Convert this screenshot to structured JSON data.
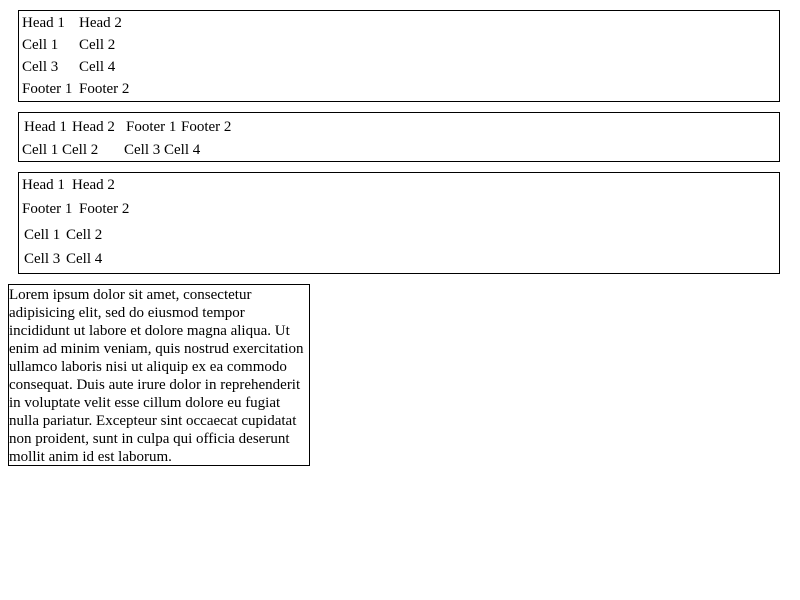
{
  "table1": {
    "head": [
      "Head 1",
      "Head 2"
    ],
    "rows": [
      [
        "Cell 1",
        "Cell 2"
      ],
      [
        "Cell 3",
        "Cell 4"
      ]
    ],
    "foot": [
      "Footer 1",
      "Footer 2"
    ]
  },
  "table2": {
    "head": [
      "Head 1",
      "Head 2"
    ],
    "foot": [
      "Footer 1",
      "Footer 2"
    ],
    "rows": [
      [
        "Cell 1",
        "Cell 2"
      ],
      [
        "Cell 3",
        "Cell 4"
      ]
    ]
  },
  "table3": {
    "head": [
      "Head 1",
      "Head 2"
    ],
    "foot": [
      "Footer 1",
      "Footer 2"
    ],
    "rows": [
      [
        "Cell 1",
        "Cell 2"
      ],
      [
        "Cell 3",
        "Cell 4"
      ]
    ]
  },
  "paragraph": {
    "text": "Lorem ipsum dolor sit amet, consectetur adipisicing elit, sed do eiusmod tempor incididunt ut labore et dolore magna aliqua. Ut enim ad minim veniam, quis nostrud exercitation ullamco laboris nisi ut aliquip ex ea commodo consequat. Duis aute irure dolor in reprehenderit in voluptate velit esse cillum dolore eu fugiat nulla pariatur. Excepteur sint occaecat cupidatat non proident, sunt in culpa qui officia deserunt mollit anim id est laborum."
  }
}
